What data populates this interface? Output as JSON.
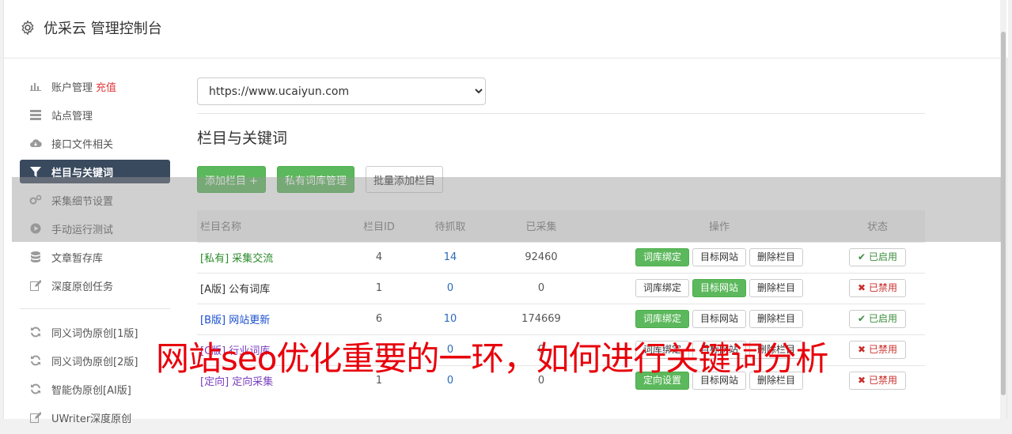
{
  "app": {
    "title": "优采云 管理控制台"
  },
  "sidebar": {
    "items": [
      {
        "label": "账户管理",
        "badge": "充值",
        "icon": "bar-chart-icon"
      },
      {
        "label": "站点管理",
        "icon": "server-icon"
      },
      {
        "label": "接口文件相关",
        "icon": "cloud-download-icon"
      },
      {
        "label": "栏目与关键词",
        "icon": "filter-icon",
        "active": true
      },
      {
        "label": "采集细节设置",
        "icon": "gears-icon"
      },
      {
        "label": "手动运行测试",
        "icon": "play-circle-icon"
      },
      {
        "label": "文章暂存库",
        "icon": "database-icon"
      },
      {
        "label": "深度原创任务",
        "icon": "edit-icon"
      }
    ],
    "tools": [
      {
        "label": "同义词伪原创[1版]",
        "icon": "refresh-icon"
      },
      {
        "label": "同义词伪原创[2版]",
        "icon": "refresh-icon"
      },
      {
        "label": "智能伪原创[AI版]",
        "icon": "refresh-icon"
      },
      {
        "label": "UWriter深度原创",
        "icon": "edit-icon"
      }
    ]
  },
  "main": {
    "site_select": {
      "value": "https://www.ucaiyun.com",
      "options": [
        "https://www.ucaiyun.com"
      ]
    },
    "section_title": "栏目与关键词",
    "buttons": {
      "add_column": "添加栏目 +",
      "private_lib": "私有词库管理",
      "batch_add": "批量添加栏目"
    },
    "table": {
      "headers": [
        "栏目名称",
        "栏目ID",
        "待抓取",
        "已采集",
        "操作",
        "状态"
      ],
      "rows": [
        {
          "prefix": "[私有]",
          "name": "采集交流",
          "id": "4",
          "pending": "14",
          "collected": "92460",
          "op1": "词库绑定",
          "op2": "目标网站",
          "op3": "删除栏目",
          "op_active": 1,
          "status": "已启用",
          "enabled": true,
          "color": "#2a8a2a"
        },
        {
          "prefix": "[A版]",
          "name": "公有词库",
          "id": "1",
          "pending": "0",
          "collected": "0",
          "op1": "词库绑定",
          "op2": "目标网站",
          "op3": "删除栏目",
          "op_active": 2,
          "status": "已禁用",
          "enabled": false,
          "color": "#333333"
        },
        {
          "prefix": "[B版]",
          "name": "网站更新",
          "id": "6",
          "pending": "10",
          "collected": "174669",
          "op1": "词库绑定",
          "op2": "目标网站",
          "op3": "删除栏目",
          "op_active": 1,
          "status": "已启用",
          "enabled": true,
          "color": "#1a4fd0"
        },
        {
          "prefix": "[C版]",
          "name": "行业词库",
          "id": "1",
          "pending": "0",
          "collected": "0",
          "op1": "词库绑定",
          "op2": "目标网站",
          "op3": "删除栏目",
          "op_active": 0,
          "status": "已禁用",
          "enabled": false,
          "color": "#7a3fbf"
        },
        {
          "prefix": "[定向]",
          "name": "定向采集",
          "id": "1",
          "pending": "0",
          "collected": "0",
          "op1": "定向设置",
          "op2": "目标网站",
          "op3": "删除栏目",
          "op_active": 1,
          "status": "已禁用",
          "enabled": false,
          "color": "#7a3fbf"
        }
      ]
    }
  },
  "overlay": {
    "caption": "网站seo优化重要的一环，如何进行关键词分析"
  },
  "colors": {
    "accent": "#5cb85c",
    "active_nav": "#3a4a5e",
    "danger": "#c9302c",
    "caption": "#e8000b"
  }
}
